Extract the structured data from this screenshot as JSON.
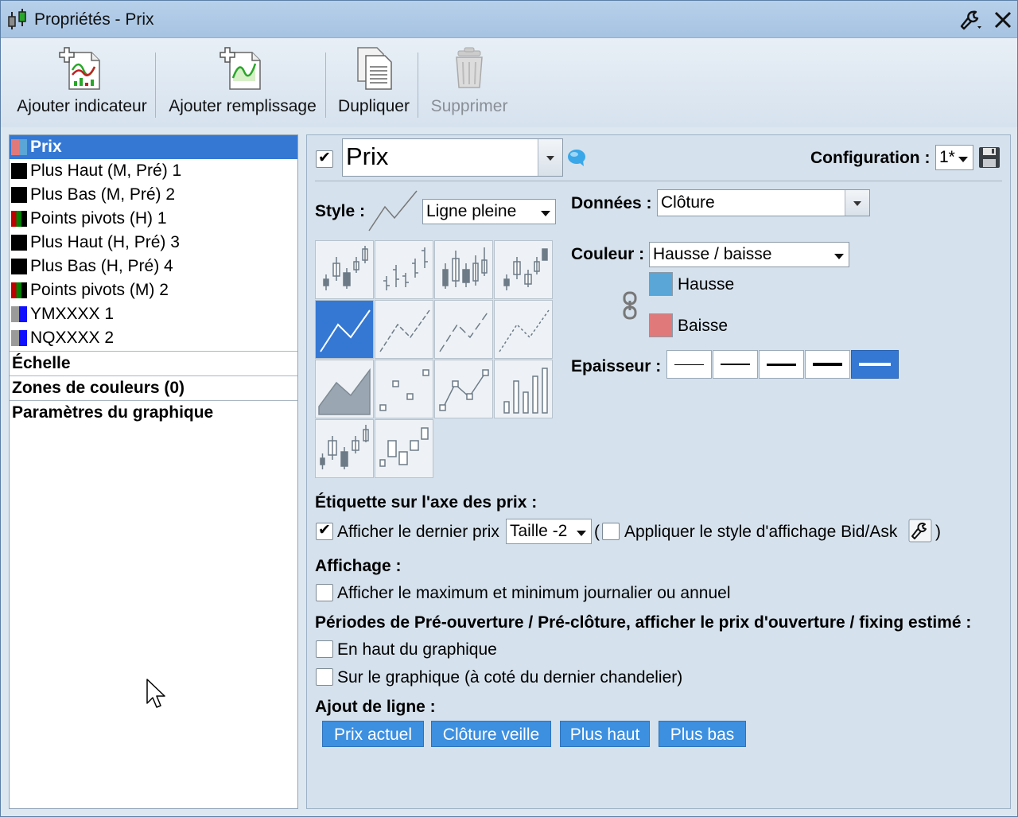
{
  "window": {
    "title": "Propriétés - Prix"
  },
  "toolbar": {
    "add_indicator": "Ajouter indicateur",
    "add_fill": "Ajouter remplissage",
    "duplicate": "Dupliquer",
    "delete": "Supprimer"
  },
  "tree": {
    "items": [
      {
        "label": "Prix",
        "colors": [
          "#e07a7a",
          "#5aa6d6"
        ]
      },
      {
        "label": "Plus Haut (M, Pré) 1",
        "colors": [
          "#000000",
          "#000000"
        ]
      },
      {
        "label": "Plus Bas (M, Pré) 2",
        "colors": [
          "#000000",
          "#000000"
        ]
      },
      {
        "label": "Points pivots (H) 1",
        "colors": [
          "#c00000",
          "#008000",
          "#000000"
        ]
      },
      {
        "label": "Plus Haut (H, Pré) 3",
        "colors": [
          "#000000",
          "#000000"
        ]
      },
      {
        "label": "Plus Bas (H, Pré) 4",
        "colors": [
          "#000000",
          "#000000"
        ]
      },
      {
        "label": "Points pivots (M) 2",
        "colors": [
          "#c00000",
          "#008000",
          "#000000"
        ]
      },
      {
        "label": "YMXXXX 1",
        "colors": [
          "#9a9a9a",
          "#1010ff"
        ]
      },
      {
        "label": "NQXXXX 2",
        "colors": [
          "#9a9a9a",
          "#1010ff"
        ]
      }
    ],
    "sections": [
      "Échelle",
      "Zones de couleurs (0)",
      "Paramètres du graphique"
    ]
  },
  "props": {
    "name": "Prix",
    "config_label": "Configuration :",
    "config_value": "1*",
    "style_label": "Style :",
    "style_value": "Ligne pleine",
    "data_label": "Données :",
    "data_value": "Clôture",
    "color_label": "Couleur :",
    "color_value": "Hausse / baisse",
    "up_label": "Hausse",
    "up_color": "#5aa6d6",
    "down_label": "Baisse",
    "down_color": "#e07a7a",
    "thickness_label": "Epaisseur :",
    "thickness_selected": 5,
    "price_axis_label": "Étiquette sur l'axe des prix :",
    "show_last_price": "Afficher le dernier prix",
    "size_value": "Taille -2",
    "paren_open": "(",
    "paren_close": ")",
    "bidask_label": "Appliquer le style d'affichage Bid/Ask",
    "display_label": "Affichage :",
    "show_minmax": "Afficher le maximum et minimum journalier ou annuel",
    "preopen_label": "Périodes de Pré-ouverture / Pré-clôture, afficher le prix d'ouverture / fixing estimé :",
    "top_of_chart": "En haut du graphique",
    "on_chart": "Sur le graphique (à coté du dernier chandelier)",
    "add_line_label": "Ajout de ligne :",
    "line_buttons": [
      "Prix actuel",
      "Clôture veille",
      "Plus haut",
      "Plus bas"
    ]
  }
}
